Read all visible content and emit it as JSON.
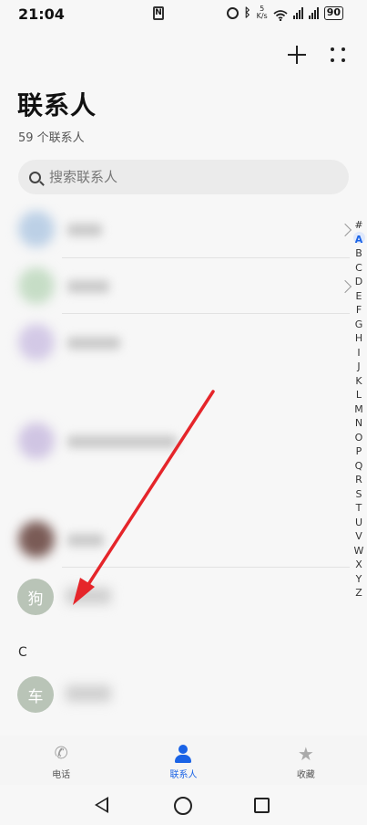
{
  "status_bar": {
    "time": "21:04",
    "nfc": "N",
    "net_speed_top": "5",
    "net_speed_bottom": "K/s",
    "battery": "90"
  },
  "header": {
    "title": "联系人",
    "count": "59 个联系人"
  },
  "search": {
    "placeholder": "搜索联系人"
  },
  "contacts": [
    {
      "avatar_char": "狗"
    },
    {
      "avatar_char": "车"
    }
  ],
  "sections": {
    "c_letter": "C"
  },
  "index_letters": [
    "#",
    "A",
    "B",
    "C",
    "D",
    "E",
    "F",
    "G",
    "H",
    "I",
    "J",
    "K",
    "L",
    "M",
    "N",
    "O",
    "P",
    "Q",
    "R",
    "S",
    "T",
    "U",
    "V",
    "W",
    "X",
    "Y",
    "Z"
  ],
  "index_highlight": "A",
  "bottom_nav": {
    "phone_label": "电话",
    "contacts_label": "联系人",
    "favorites_label": "收藏"
  },
  "colors": {
    "accent": "#1a63e6",
    "annotation_arrow": "#e5252a",
    "avatar": "#b9c4b7"
  }
}
